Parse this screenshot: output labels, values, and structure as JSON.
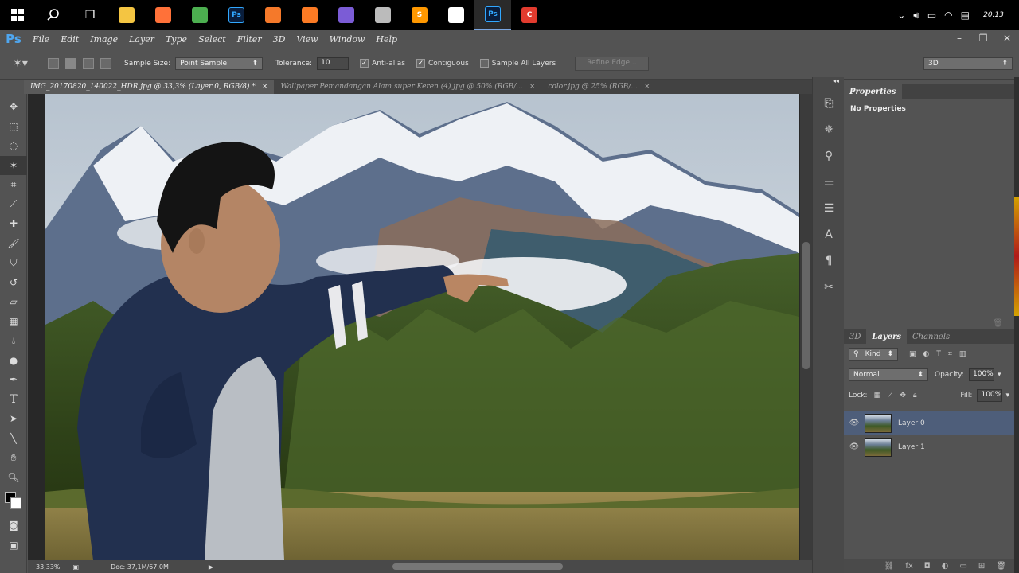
{
  "taskbar": {
    "apps": [
      {
        "name": "task-view-icon",
        "glyph": "❐",
        "color": "#ffffff",
        "active": false
      },
      {
        "name": "file-explorer-icon",
        "glyph": "",
        "color": "#f4c542",
        "active": false
      },
      {
        "name": "firefox-icon",
        "glyph": "",
        "color": "#ff7139",
        "active": false
      },
      {
        "name": "chrome-icon",
        "glyph": "",
        "color": "#4caf50",
        "active": false
      },
      {
        "name": "photoshop-app-icon",
        "glyph": "Ps",
        "color": "#0a1e3c",
        "active": false
      },
      {
        "name": "blender-icon",
        "glyph": "",
        "color": "#f5792a",
        "active": false
      },
      {
        "name": "xampp-icon",
        "glyph": "",
        "color": "#fb7a24",
        "active": false
      },
      {
        "name": "purple-app-icon",
        "glyph": "",
        "color": "#7b5cd6",
        "active": false
      },
      {
        "name": "gear-app-icon",
        "glyph": "",
        "color": "#bbbbbb",
        "active": false
      },
      {
        "name": "sublime-text-icon",
        "glyph": "S",
        "color": "#ff9800",
        "active": false
      },
      {
        "name": "unity-icon",
        "glyph": "",
        "color": "#ffffff",
        "active": false
      },
      {
        "name": "photoshop-active-icon",
        "glyph": "Ps",
        "color": "#0a1e3c",
        "active": true
      },
      {
        "name": "red-app-icon",
        "glyph": "C",
        "color": "#e23b2e",
        "active": false
      }
    ],
    "clock": "20.13"
  },
  "menu": [
    "File",
    "Edit",
    "Image",
    "Layer",
    "Type",
    "Select",
    "Filter",
    "3D",
    "View",
    "Window",
    "Help"
  ],
  "options": {
    "sample_size_label": "Sample Size:",
    "sample_size_value": "Point Sample",
    "tolerance_label": "Tolerance:",
    "tolerance_value": "10",
    "anti_alias": "Anti-alias",
    "contiguous": "Contiguous",
    "sample_all": "Sample All Layers",
    "refine_edge": "Refine Edge...",
    "workspace": "3D"
  },
  "tabs": [
    {
      "label": "IMG_20170820_140022_HDR.jpg @ 33,3% (Layer 0, RGB/8) *",
      "active": true
    },
    {
      "label": "Wallpaper Pemandangan Alam super Keren (4).jpg @ 50% (RGB/...",
      "active": false
    },
    {
      "label": "color.jpg @ 25% (RGB/...",
      "active": false
    }
  ],
  "status": {
    "zoom": "33,33%",
    "doc": "Doc: 37,1M/67,0M"
  },
  "properties": {
    "title": "Properties",
    "body": "No Properties"
  },
  "layers_panel": {
    "tabs": [
      "3D",
      "Layers",
      "Channels"
    ],
    "kind": "Kind",
    "blend_mode": "Normal",
    "opacity_label": "Opacity:",
    "opacity_value": "100%",
    "lock_label": "Lock:",
    "fill_label": "Fill:",
    "fill_value": "100%",
    "layers": [
      {
        "name": "Layer 0",
        "selected": true
      },
      {
        "name": "Layer 1",
        "selected": false
      }
    ]
  }
}
